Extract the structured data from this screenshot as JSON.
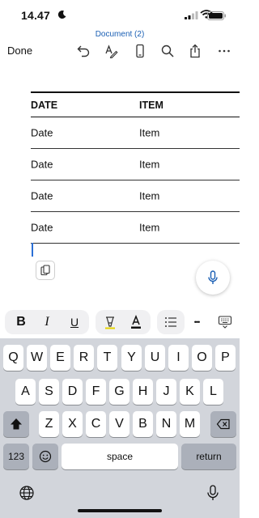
{
  "status": {
    "time": "14.47"
  },
  "toolbar": {
    "document_title": "Document (2)",
    "done_label": "Done"
  },
  "table": {
    "headers": [
      "DATE",
      "ITEM"
    ],
    "rows": [
      [
        "Date",
        "Item"
      ],
      [
        "Date",
        "Item"
      ],
      [
        "Date",
        "Item"
      ],
      [
        "Date",
        "Item"
      ]
    ]
  },
  "format_bar": {
    "bold": "B",
    "italic": "I",
    "underline": "U",
    "more": "•••"
  },
  "keyboard": {
    "row1": [
      "Q",
      "W",
      "E",
      "R",
      "T",
      "Y",
      "U",
      "I",
      "O",
      "P"
    ],
    "row2": [
      "A",
      "S",
      "D",
      "F",
      "G",
      "H",
      "J",
      "K",
      "L"
    ],
    "row3": [
      "Z",
      "X",
      "C",
      "V",
      "B",
      "N",
      "M"
    ],
    "numbers_label": "123",
    "space_label": "space",
    "return_label": "return"
  },
  "colors": {
    "accent": "#1a5fb4",
    "keyboard_bg": "#d2d5db",
    "special_key": "#abb0ba"
  }
}
